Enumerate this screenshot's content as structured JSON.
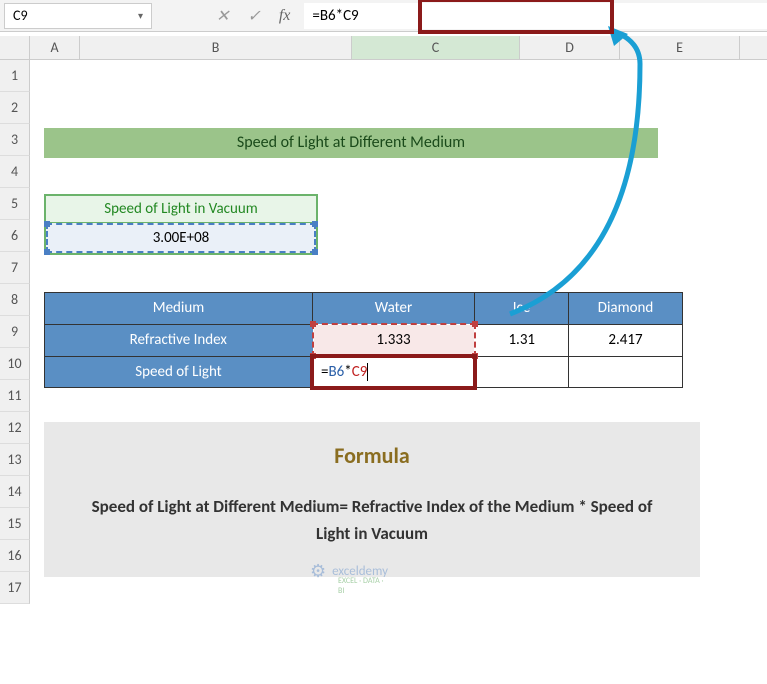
{
  "nameBox": "C9",
  "formulaBar": "=B6*C9",
  "columns": [
    "A",
    "B",
    "C",
    "D",
    "E"
  ],
  "rows": [
    "1",
    "2",
    "3",
    "4",
    "5",
    "6",
    "7",
    "8",
    "9",
    "10",
    "11",
    "12",
    "13",
    "14",
    "15",
    "16",
    "17"
  ],
  "title": "Speed of Light at Different Medium",
  "vacuum": {
    "label": "Speed of Light in Vacuum",
    "value": "3.00E+08"
  },
  "table": {
    "headers": [
      "Medium",
      "Water",
      "Ice",
      "Diamond"
    ],
    "rows": [
      {
        "label": "Refractive Index",
        "c": "1.333",
        "d": "1.31",
        "e": "2.417"
      },
      {
        "label": "Speed of Light",
        "c_formula": {
          "b6": "B6",
          "op": "*",
          "c9": "C9",
          "eq": "="
        },
        "d": "",
        "e": ""
      }
    ]
  },
  "formulaBox": {
    "title": "Formula",
    "desc": "Speed of Light at Different Medium= Refractive Index of the Medium * Speed of Light in Vacuum"
  },
  "watermark": {
    "name": "exceldemy",
    "tag": "EXCEL · DATA · BI"
  }
}
